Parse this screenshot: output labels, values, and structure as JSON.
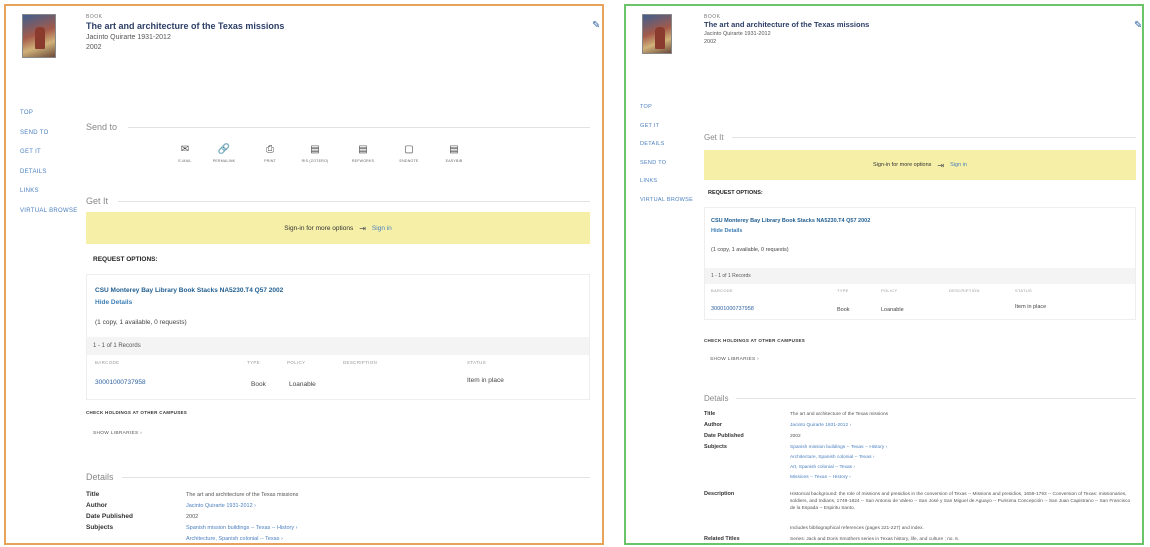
{
  "record": {
    "type": "BOOK",
    "title": "The art and architecture of the Texas missions",
    "author": "Jacinto Quirarte 1931-2012",
    "date": "2002"
  },
  "nav_a": [
    "TOP",
    "SEND TO",
    "GET IT",
    "DETAILS",
    "LINKS",
    "VIRTUAL BROWSE"
  ],
  "nav_b": [
    "TOP",
    "GET IT",
    "DETAILS",
    "SEND TO",
    "LINKS",
    "VIRTUAL BROWSE"
  ],
  "sections": {
    "send_to": "Send to",
    "get_it": "Get It",
    "details": "Details"
  },
  "send_to_items": [
    {
      "label": "E-MAIL",
      "icon": "envelope-icon"
    },
    {
      "label": "PERMALINK",
      "icon": "link-icon"
    },
    {
      "label": "PRINT",
      "icon": "printer-icon"
    },
    {
      "label": "RIS (ZOTERO)",
      "icon": "document-icon"
    },
    {
      "label": "REFWORKS",
      "icon": "document-icon"
    },
    {
      "label": "ENDNOTE",
      "icon": "document-icon"
    },
    {
      "label": "EASYBIB",
      "icon": "document-icon"
    }
  ],
  "signin": {
    "message": "Sign-in for more options",
    "link": "Sign in"
  },
  "request_options": "REQUEST OPTIONS:",
  "holding": {
    "location": "CSU Monterey Bay Library   Book Stacks   NA5230.T4 Q57 2002",
    "hide_details": "Hide Details",
    "availability": "(1 copy, 1 available, 0 requests)",
    "records": "1 - 1 of 1 Records",
    "columns": [
      "BARCODE",
      "TYPE",
      "POLICY",
      "DESCRIPTION",
      "STATUS"
    ],
    "row": {
      "barcode": "30001000737958",
      "type": "Book",
      "policy": "Loanable",
      "description": "",
      "status": "Item in place"
    }
  },
  "check_holdings": "CHECK HOLDINGS AT OTHER CAMPUSES",
  "show_libraries": "SHOW LIBRARIES ›",
  "details": {
    "title_label": "Title",
    "title": "The art and architecture of the Texas missions",
    "author_label": "Author",
    "author": "Jacinto Quirarte 1931-2012  ›",
    "date_label": "Date Published",
    "date": "2002",
    "subjects_label": "Subjects",
    "subjects": [
      "Spanish mission buildings -- Texas -- History  ›",
      "Architecture, Spanish colonial -- Texas  ›",
      "Art, Spanish colonial -- Texas  ›",
      "Missions -- Texas -- History  ›"
    ],
    "description_label": "Description",
    "description": "Historical background: the role of missions and presidios in the conversion of Texas -- Missions and presidios, 1659-1793 -- Conversion of Texas: missionaries, soldiers, and Indians, 1749-1824 -- San Antonio de Valero -- San José y San Miguel de Aguayo -- Purisima Concepción -- San Juan Capistrano -- San Francisco de la Espada -- Espiritu Santo.",
    "description_note": "Includes bibliographical references (pages 221-227) and index.",
    "related_label": "Related Titles",
    "related": "Series: Jack and Doris Smothers series in Texas history, life, and culture ; no. 6."
  },
  "colors": {
    "panel_a_border": "#e8a35a",
    "panel_b_border": "#6cc46a",
    "signin_bg": "#f5efa8",
    "link": "#4a7fbf"
  }
}
